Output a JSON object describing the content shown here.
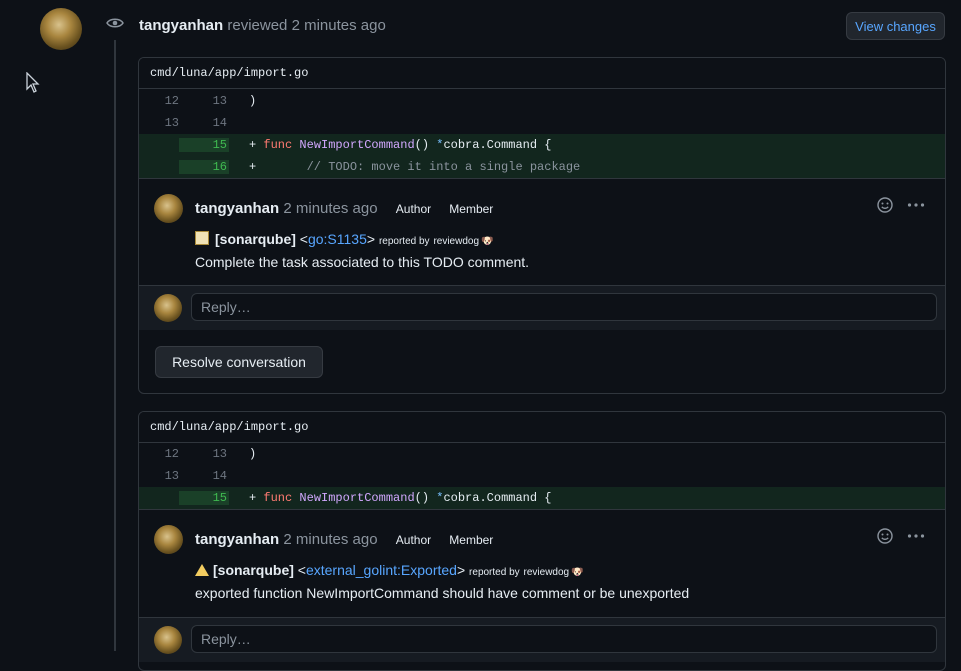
{
  "review": {
    "author": "tangyanhan",
    "action": "reviewed",
    "time": "2 minutes ago",
    "view_changes_label": "View changes"
  },
  "threads": [
    {
      "file": "cmd/luna/app/import.go",
      "lines": [
        {
          "old": "12",
          "new": "13",
          "type": "context",
          "code": ")"
        },
        {
          "old": "13",
          "new": "14",
          "type": "context",
          "code": ""
        },
        {
          "old": "",
          "new": "15",
          "type": "add",
          "code": "+ func NewImportCommand() *cobra.Command {"
        },
        {
          "old": "",
          "new": "16",
          "type": "add",
          "code": "+       // TODO: move it into a single package"
        }
      ],
      "comment": {
        "author": "tangyanhan",
        "time": "2 minutes ago",
        "badge1": "Author",
        "badge2": "Member",
        "tag": "[sonarqube]",
        "rule": "go:S1135",
        "reported_by": "reported by",
        "reporter": "reviewdog",
        "message": "Complete the task associated to this TODO comment."
      },
      "reply_placeholder": "Reply…",
      "resolve_label": "Resolve conversation"
    },
    {
      "file": "cmd/luna/app/import.go",
      "lines": [
        {
          "old": "12",
          "new": "13",
          "type": "context",
          "code": ")"
        },
        {
          "old": "13",
          "new": "14",
          "type": "context",
          "code": ""
        },
        {
          "old": "",
          "new": "15",
          "type": "add",
          "code": "+ func NewImportCommand() *cobra.Command {"
        }
      ],
      "comment": {
        "author": "tangyanhan",
        "time": "2 minutes ago",
        "badge1": "Author",
        "badge2": "Member",
        "tag": "[sonarqube]",
        "rule": "external_golint:Exported",
        "reported_by": "reported by",
        "reporter": "reviewdog",
        "message": "exported function NewImportCommand should have comment or be unexported"
      },
      "reply_placeholder": "Reply…"
    }
  ],
  "colors": {
    "background": "#0d1117",
    "link": "#58a6ff",
    "added_line": "#12261e",
    "added_number": "#3fb950"
  }
}
